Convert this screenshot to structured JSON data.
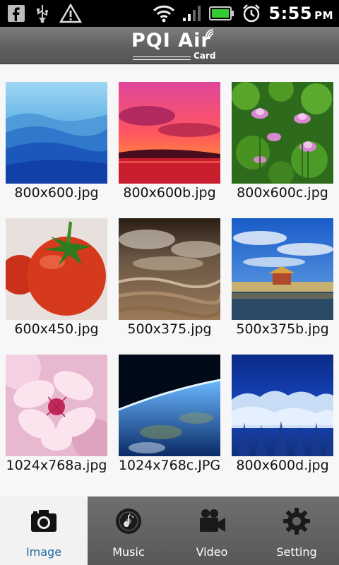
{
  "status_bar": {
    "time": "5:55",
    "ampm": "PM",
    "left_icons": [
      "facebook-icon",
      "usb-icon",
      "warning-icon"
    ],
    "right_icons": [
      "wifi-icon",
      "signal-icon",
      "battery-icon",
      "alarm-icon"
    ]
  },
  "header": {
    "logo_text": "PQI Air",
    "logo_sub": "Card"
  },
  "gallery": {
    "items": [
      {
        "name": "800x600.jpg",
        "picture": "blue-mountains"
      },
      {
        "name": "800x600b.jpg",
        "picture": "red-sunset"
      },
      {
        "name": "800x600c.jpg",
        "picture": "lotus-flowers"
      },
      {
        "name": "600x450.jpg",
        "picture": "tomato"
      },
      {
        "name": "500x375.jpg",
        "picture": "river-rapids"
      },
      {
        "name": "500x375b.jpg",
        "picture": "palace-lake"
      },
      {
        "name": "1024x768a.jpg",
        "picture": "pink-blossom"
      },
      {
        "name": "1024x768c.JPG",
        "picture": "earth-from-space"
      },
      {
        "name": "800x600d.jpg",
        "picture": "snowy-forest"
      }
    ]
  },
  "tabs": [
    {
      "label": "Image",
      "icon": "camera-icon",
      "active": true
    },
    {
      "label": "Music",
      "icon": "music-disc-icon",
      "active": false
    },
    {
      "label": "Video",
      "icon": "video-camera-icon",
      "active": false
    },
    {
      "label": "Setting",
      "icon": "gear-icon",
      "active": false
    }
  ],
  "colors": {
    "active_tab_label": "#1f6ca3",
    "tab_bar_inactive": "#5f615f",
    "header": "#5f615f"
  }
}
